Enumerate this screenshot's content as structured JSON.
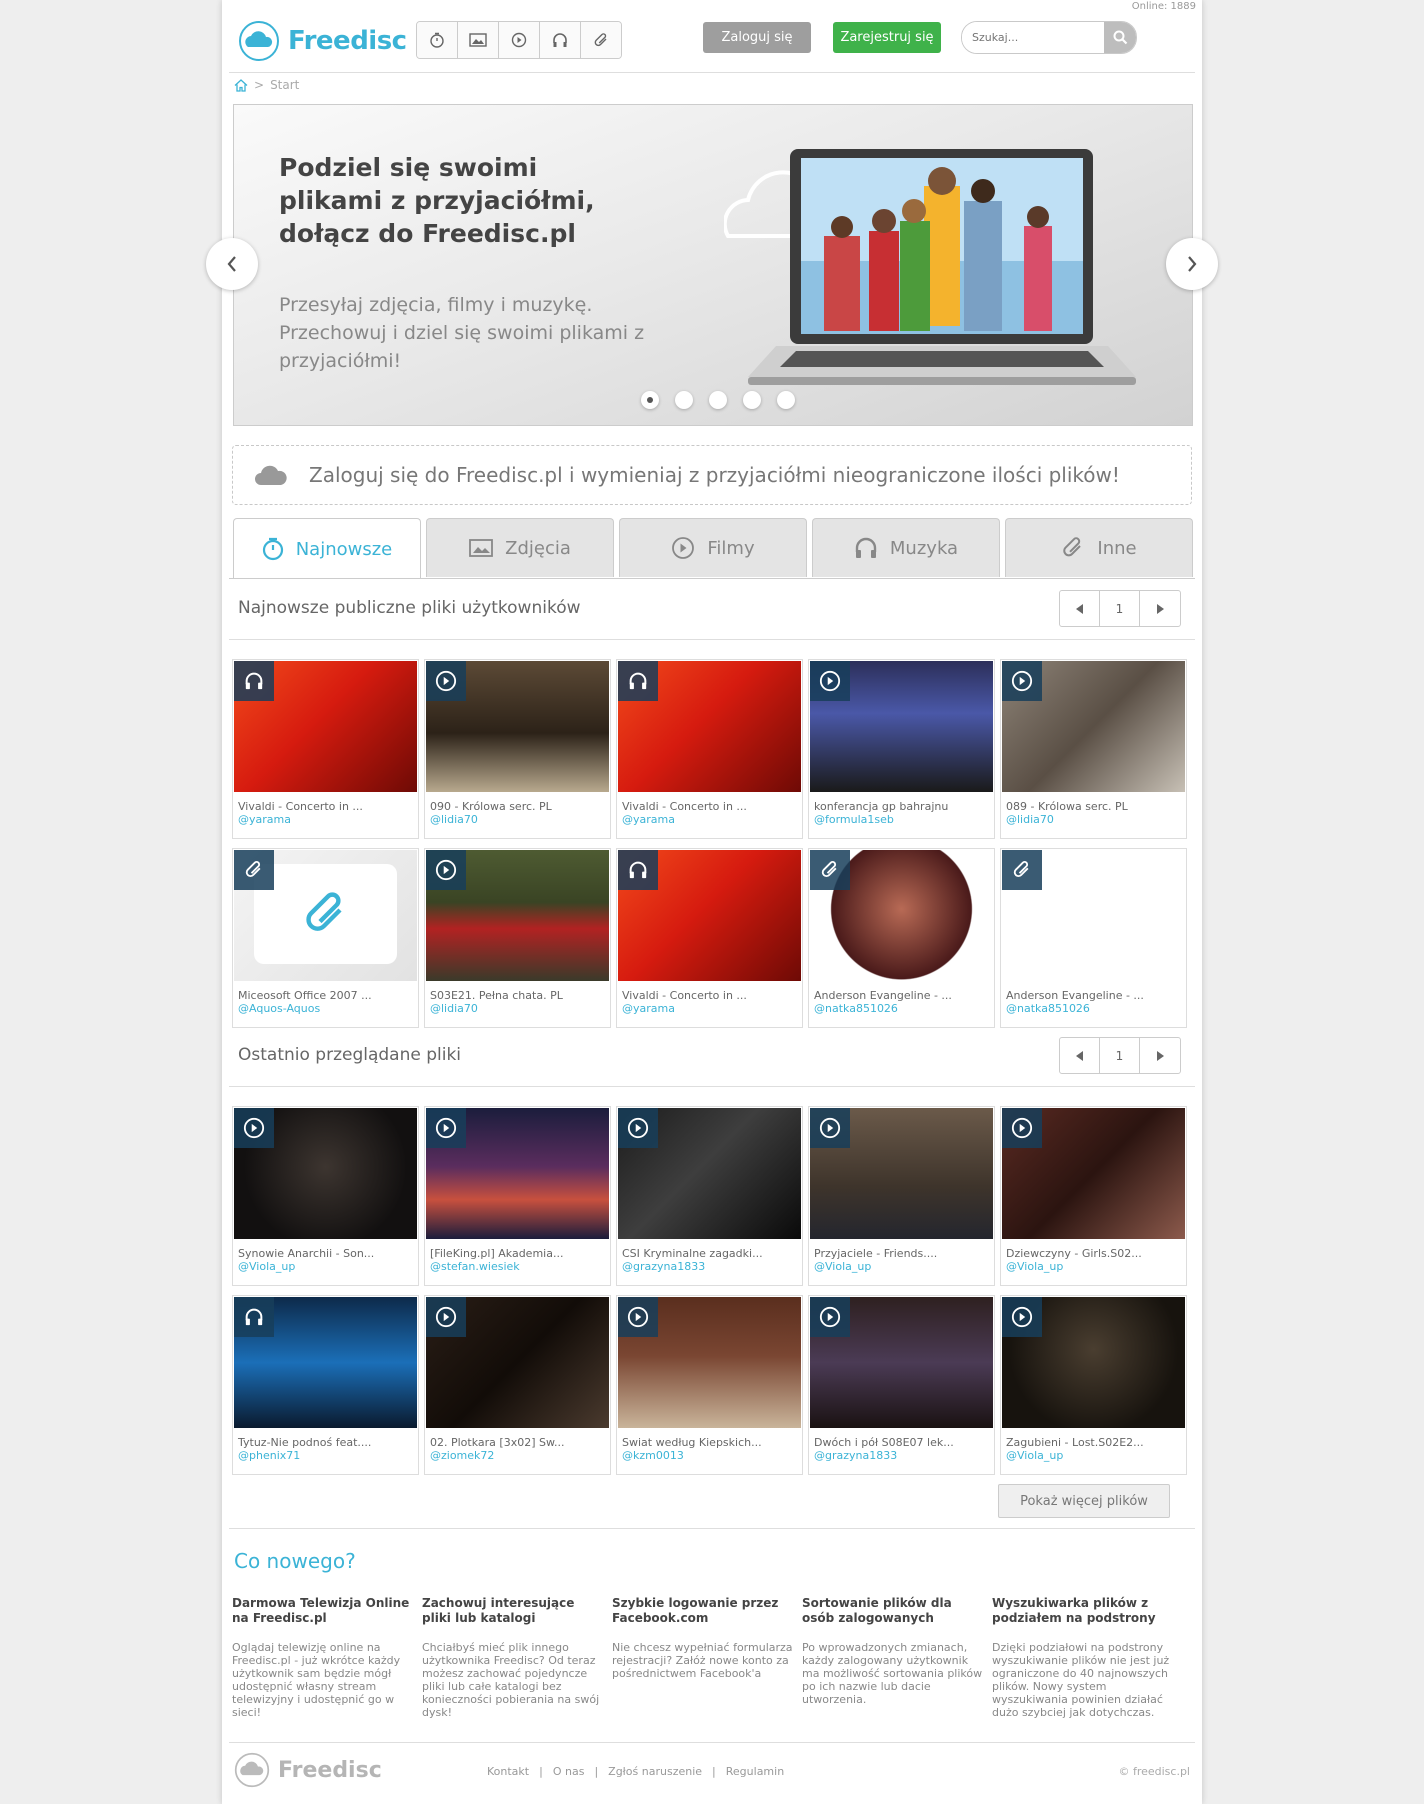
{
  "header": {
    "online": "Online: 1889",
    "logo_text": "Freedisc",
    "login_label": "Zaloguj się",
    "register_label": "Zarejestruj się",
    "search_placeholder": "Szukaj..."
  },
  "breadcrumb": {
    "current": "Start"
  },
  "slider": {
    "heading": "Podziel się swoimi plikami z przyjaciółmi, dołącz do Freedisc.pl",
    "text": "Przesyłaj zdjęcia, filmy i muzykę. Przechowuj i dziel się swoimi plikami z przyjaciółmi!",
    "dots": 5,
    "active_dot": 1
  },
  "promo": {
    "text": "Zaloguj się do Freedisc.pl i wymieniaj z przyjaciółmi nieograniczone ilości plików!"
  },
  "tabs": [
    {
      "label": "Najnowsze",
      "icon": "stopwatch-icon"
    },
    {
      "label": "Zdjęcia",
      "icon": "image-icon"
    },
    {
      "label": "Filmy",
      "icon": "play-icon"
    },
    {
      "label": "Muzyka",
      "icon": "headphones-icon"
    },
    {
      "label": "Inne",
      "icon": "paperclip-icon"
    }
  ],
  "newest": {
    "title": "Najnowsze publiczne pliki użytkowników",
    "page": "1",
    "items": [
      {
        "type": "music",
        "title": "Vivaldi - Concerto in ...",
        "user": "@yarama",
        "thumb": "vivaldi"
      },
      {
        "type": "video",
        "title": "090 - Królowa serc. PL",
        "user": "@lidia70",
        "thumb": "room"
      },
      {
        "type": "music",
        "title": "Vivaldi - Concerto in ...",
        "user": "@yarama",
        "thumb": "vivaldi"
      },
      {
        "type": "video",
        "title": "konferancja gp bahrajnu",
        "user": "@formula1seb",
        "thumb": "conference"
      },
      {
        "type": "video",
        "title": "089 - Królowa serc. PL",
        "user": "@lidia70",
        "thumb": "face"
      },
      {
        "type": "other",
        "title": "Miceosoft Office 2007 ...",
        "user": "@Aquos-Aquos",
        "thumb": "clip"
      },
      {
        "type": "video",
        "title": "S03E21. Pełna chata. PL",
        "user": "@lidia70",
        "thumb": "redshirt"
      },
      {
        "type": "music",
        "title": "Vivaldi - Concerto in ...",
        "user": "@yarama",
        "thumb": "vivaldi"
      },
      {
        "type": "other",
        "title": "Anderson Evangeline - ...",
        "user": "@natka851026",
        "thumb": "book"
      },
      {
        "type": "other",
        "title": "Anderson Evangeline - ...",
        "user": "@natka851026",
        "thumb": "bookwhite"
      }
    ]
  },
  "recent": {
    "title": "Ostatnio przeglądane pliki",
    "page": "1",
    "items": [
      {
        "type": "video",
        "title": "Synowie Anarchii - Son...",
        "user": "@Viola_up",
        "thumb": "dark"
      },
      {
        "type": "video",
        "title": "[FileKing.pl] Akademia...",
        "user": "@stefan.wiesiek",
        "thumb": "reliance"
      },
      {
        "type": "video",
        "title": "CSI Kryminalne zagadki...",
        "user": "@grazyna1833",
        "thumb": "csi"
      },
      {
        "type": "video",
        "title": "Przyjaciele - Friends....",
        "user": "@Viola_up",
        "thumb": "friends"
      },
      {
        "type": "video",
        "title": "Dziewczyny - Girls.S02...",
        "user": "@Viola_up",
        "thumb": "girls"
      },
      {
        "type": "music",
        "title": "Tytuz-Nie podnoś feat....",
        "user": "@phenix71",
        "thumb": "ms2"
      },
      {
        "type": "video",
        "title": "02. Plotkara [3x02] Sw...",
        "user": "@ziomek72",
        "thumb": "gossip"
      },
      {
        "type": "video",
        "title": "Swiat według Kiepskich...",
        "user": "@kzm0013",
        "thumb": "kiepscy"
      },
      {
        "type": "video",
        "title": "Dwóch i pół S08E07 lek...",
        "user": "@grazyna1833",
        "thumb": "twohalf"
      },
      {
        "type": "video",
        "title": "Zagubieni - Lost.S02E2...",
        "user": "@Viola_up",
        "thumb": "lost"
      }
    ]
  },
  "more_label": "Pokaż więcej plików",
  "news": {
    "heading": "Co nowego?",
    "items": [
      {
        "title": "Darmowa Telewizja Online na Freedisc.pl",
        "text": "Oglądaj telewizję online na Freedisc.pl - już wkrótce każdy użytkownik sam będzie mógł udostępnić własny stream telewizyjny i udostępnić go w sieci!"
      },
      {
        "title": "Zachowuj interesujące pliki lub katalogi",
        "text": "Chciałbyś mieć plik innego użytkownika Freedisc? Od teraz możesz zachować pojedyncze pliki lub całe katalogi bez konieczności pobierania na swój dysk!"
      },
      {
        "title": "Szybkie logowanie przez Facebook.com",
        "text": "Nie chcesz wypełniać formularza rejestracji? Załóż nowe konto za pośrednictwem Facebook'a"
      },
      {
        "title": "Sortowanie plików dla osób zalogowanych",
        "text": "Po wprowadzonych zmianach, każdy zalogowany użytkownik ma możliwość sortowania plików po ich nazwie lub dacie utworzenia."
      },
      {
        "title": "Wyszukiwarka plików z podziałem na podstrony",
        "text": "Dzięki podziałowi na podstrony wyszukiwanie plików nie jest już ograniczone do 40 najnowszych plików. Nowy system wyszukiwania powinien działać dużo szybciej jak dotychczas."
      }
    ]
  },
  "footer": {
    "logo_text": "Freedisc",
    "links": [
      "Kontakt",
      "O nas",
      "Zgłoś naruszenie",
      "Regulamin"
    ],
    "separator": "|",
    "copyright": "© freedisc.pl"
  },
  "colors": {
    "accent": "#3bb3d6",
    "login": "#9e9e9e",
    "register": "#3fb24a",
    "badge": "#183e5a"
  }
}
